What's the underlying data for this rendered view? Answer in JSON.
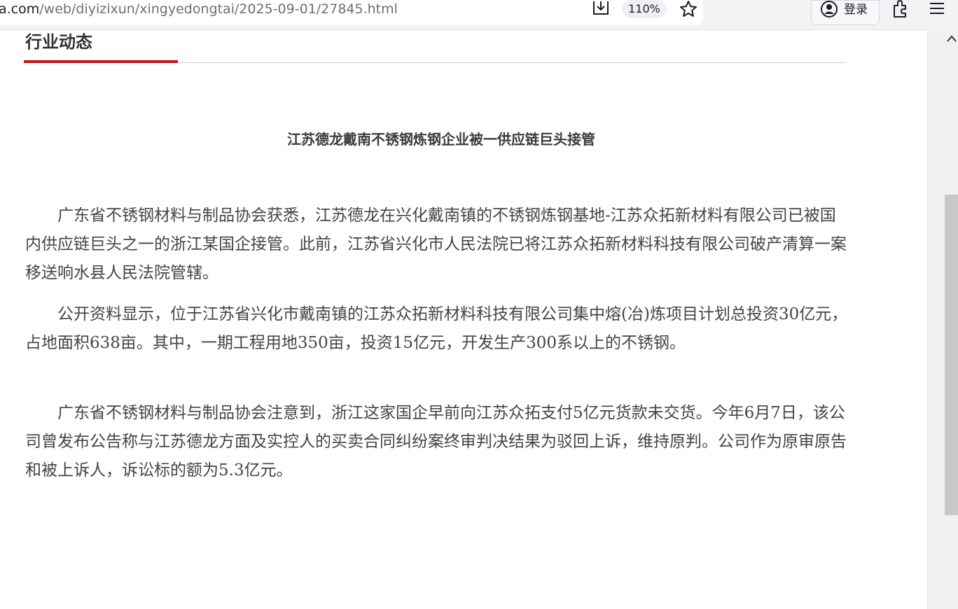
{
  "browser": {
    "url_host": "a.com",
    "url_path": "/web/diyizixun/xingyedongtai/2025-09-01/27845.html",
    "zoom": "110%",
    "login_label": "登录",
    "icons": [
      "download-icon",
      "bookmark-star-icon",
      "account-icon",
      "extensions-icon",
      "menu-icon"
    ]
  },
  "page": {
    "section_title": "行业动态",
    "article_title": "江苏德龙戴南不锈钢炼钢企业被一供应链巨头接管",
    "paragraphs": [
      "广东省不锈钢材料与制品协会获悉，江苏德龙在兴化戴南镇的不锈钢炼钢基地-江苏众拓新材料有限公司已被国内供应链巨头之一的浙江某国企接管。此前，江苏省兴化市人民法院已将江苏众拓新材料科技有限公司破产清算一案移送响水县人民法院管辖。",
      "公开资料显示，位于江苏省兴化市戴南镇的江苏众拓新材料科技有限公司集中熔(冶)炼项目计划总投资30亿元，占地面积638亩。其中，一期工程用地350亩，投资15亿元，开发生产300系以上的不锈钢。",
      "广东省不锈钢材料与制品协会注意到，浙江这家国企早前向江苏众拓支付5亿元货款未交货。今年6月7日，该公司曾发布公告称与江苏德龙方面及实控人的买卖合同纠纷案终审判决结果为驳回上诉，维持原判。公司作为原审原告和被上诉人，诉讼标的额为5.3亿元。"
    ]
  },
  "colors": {
    "accent": "#c4161c",
    "text": "#444444",
    "toolbar_bg": "#f3f3f5"
  }
}
